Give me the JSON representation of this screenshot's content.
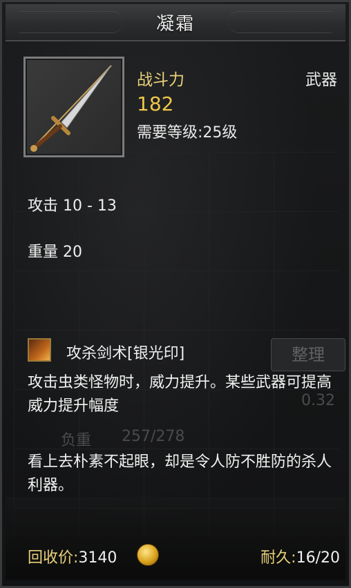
{
  "tooltip": {
    "title": "凝霜",
    "power_label": "战斗力",
    "power_value": "182",
    "item_type": "武器",
    "required_level": "需要等级:25级",
    "attack": "攻击 10 - 13",
    "weight": "重量 20",
    "skill": {
      "name": "攻杀剑术[银光印]",
      "description": "攻击虫类怪物时，威力提升。某些武器可提高威力提升幅度",
      "icon": "flame-sword-icon"
    },
    "flavor_text": "看上去朴素不起眼，却是令人防不胜防的杀人利器。",
    "recycle_label": "回收价:",
    "recycle_value": "3140",
    "durability_label": "耐久:",
    "durability_value": "16/20",
    "item_icon": "sword-icon"
  },
  "background": {
    "sort_button": "整理",
    "ghost_value": "0.32",
    "ghost_weight_label": "负重",
    "ghost_weight_value": "257/278"
  },
  "colors": {
    "gold_label": "#e9d27a",
    "power_value": "#f0c84a",
    "text": "#efefef"
  }
}
